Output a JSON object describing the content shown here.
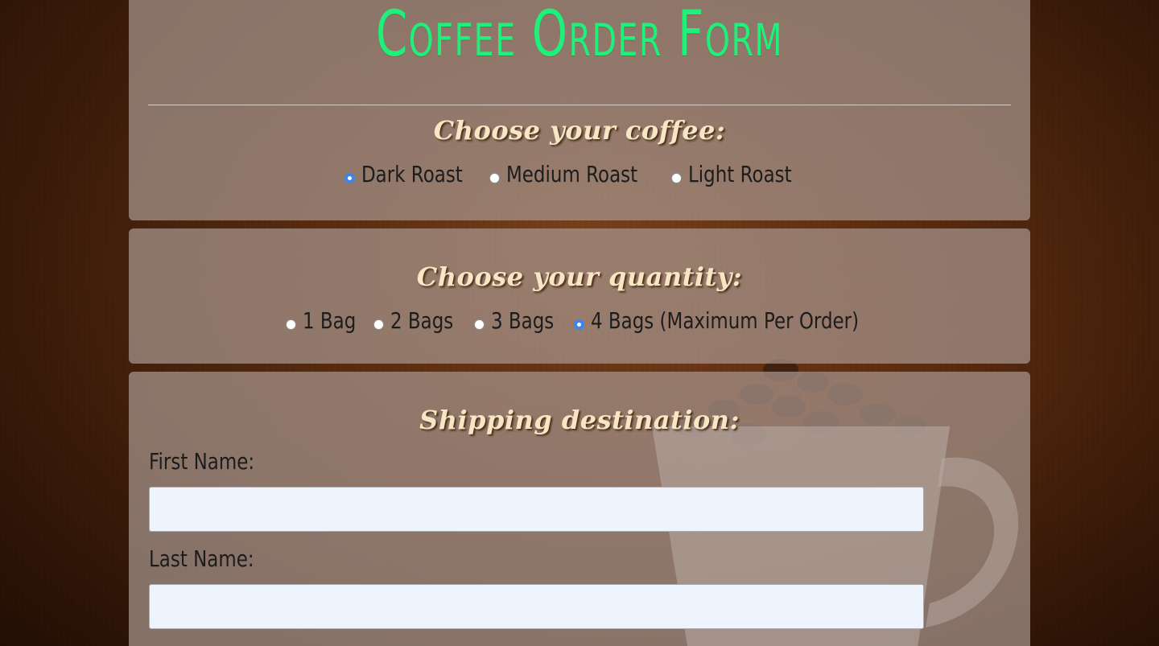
{
  "form": {
    "title": "Coffee Order Form"
  },
  "coffee": {
    "heading": "Choose your coffee:",
    "options": [
      {
        "label": "Dark Roast",
        "checked": true
      },
      {
        "label": "Medium Roast",
        "checked": false
      },
      {
        "label": "Light Roast",
        "checked": false
      }
    ]
  },
  "quantity": {
    "heading": "Choose your quantity:",
    "options": [
      {
        "label": "1 Bag",
        "checked": false
      },
      {
        "label": "2 Bags",
        "checked": false
      },
      {
        "label": "3 Bags",
        "checked": false
      },
      {
        "label": "4 Bags (Maximum Per Order)",
        "checked": true
      }
    ]
  },
  "shipping": {
    "heading": "Shipping destination:",
    "first_name_label": "First Name:",
    "first_name_value": "",
    "last_name_label": "Last Name:",
    "last_name_value": ""
  },
  "colors": {
    "title": "#1ef07a",
    "heading": "#f6e6c4",
    "radio_checked": "#3d85e8",
    "input_bg": "#edf4fd"
  }
}
